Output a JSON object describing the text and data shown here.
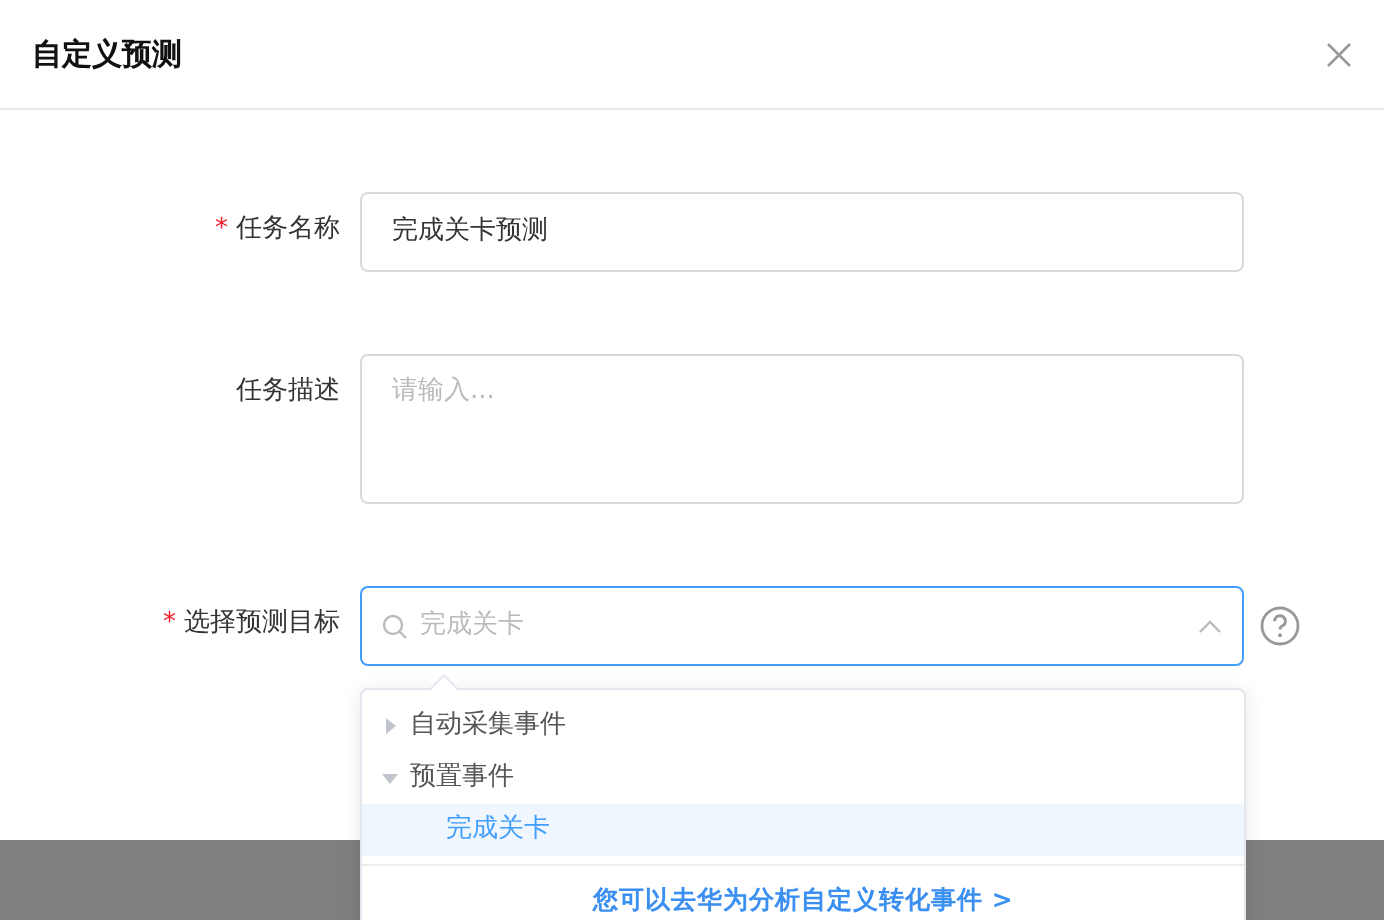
{
  "dialog": {
    "title": "自定义预测"
  },
  "fields": [
    {
      "kind": "input",
      "mark": "*",
      "label": "任务名称",
      "value": "完成关卡预测"
    },
    {
      "kind": "textarea",
      "label": "任务描述",
      "placeholder": "请输入..."
    },
    {
      "kind": "select",
      "mark": "*",
      "label": "选择预测目标",
      "placeholder": "完成关卡",
      "expanded": true,
      "help": true
    }
  ],
  "dropdown": {
    "tree": [
      {
        "label": "自动采集事件",
        "expanded": false,
        "selected": false
      },
      {
        "label": "预置事件",
        "expanded": true,
        "selected": false,
        "children": [
          {
            "label": "完成关卡",
            "selected": true
          }
        ]
      }
    ],
    "footer_link": "您可以去华为分析自定义转化事件 >"
  }
}
